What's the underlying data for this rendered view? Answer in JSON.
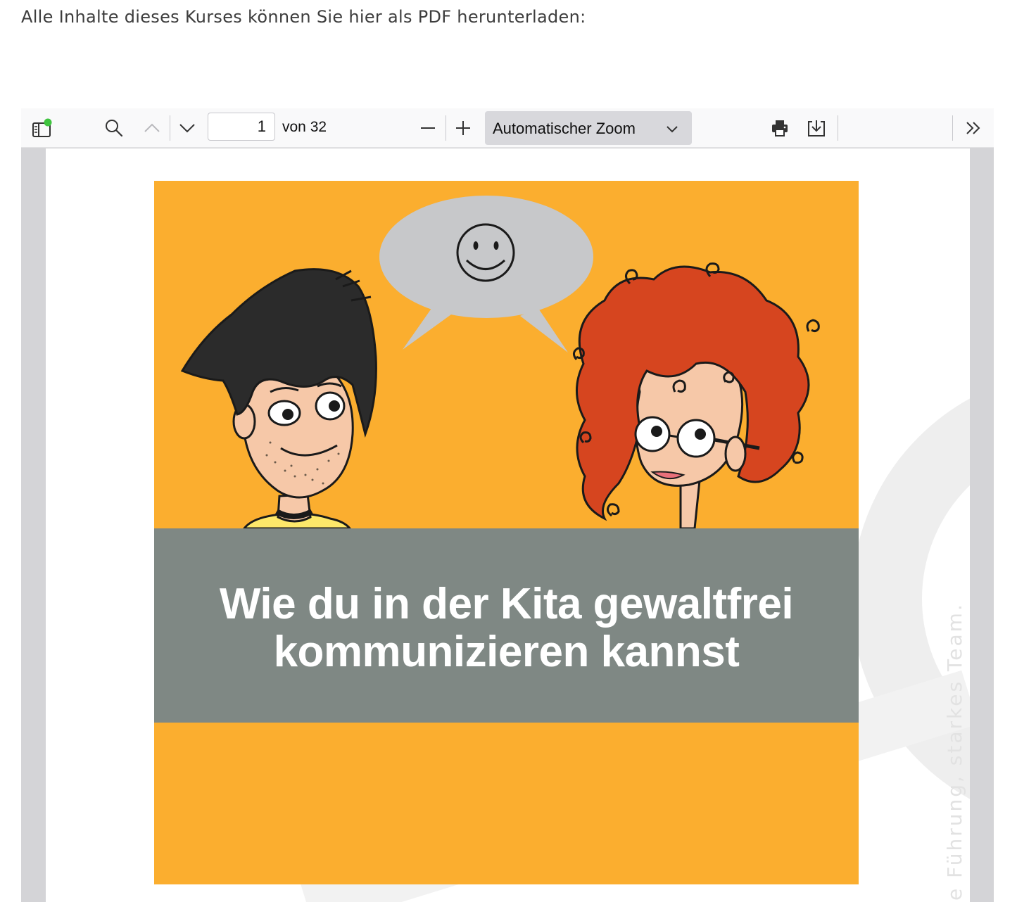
{
  "intro_text": "Alle Inhalte dieses Kurses können Sie hier als PDF herunterladen:",
  "toolbar": {
    "page_number": "1",
    "page_count": "von 32",
    "zoom": "Automatischer Zoom",
    "icons": [
      "sidebar-toggle-icon",
      "search-icon",
      "previous-page-icon",
      "next-page-icon",
      "zoom-out-icon",
      "zoom-in-icon",
      "chevron-down-icon",
      "print-icon",
      "download-icon",
      "tools-icon"
    ],
    "status_dot_color": "#3fc43f"
  },
  "document": {
    "cover_title_line1": "Wie du in der Kita gewaltfrei",
    "cover_title_line2": "kommunizieren kannst",
    "side_text": "e Führung, starkes Team.",
    "colors": {
      "cover_background": "#fbae2f",
      "banner": "#7f8884",
      "title_text": "#ffffff"
    }
  }
}
